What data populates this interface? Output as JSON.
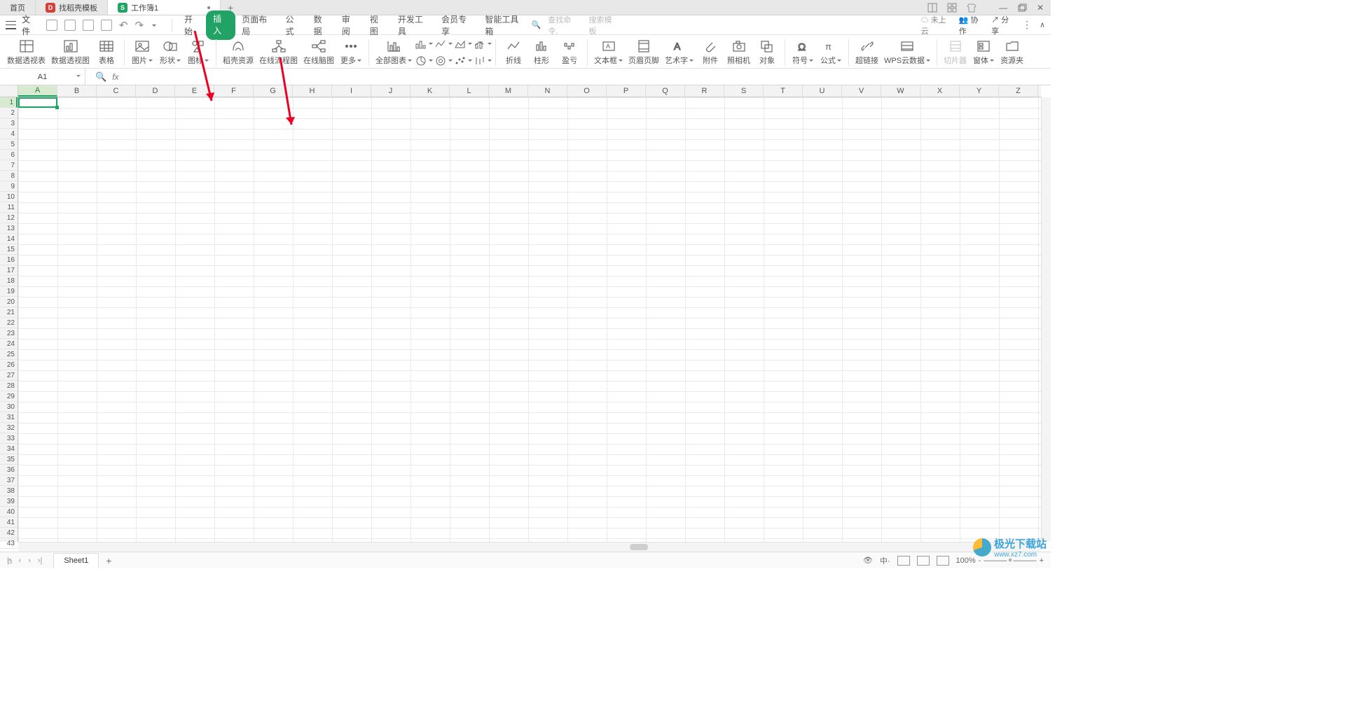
{
  "tabs": {
    "home": "首页",
    "template": "找稻壳模板",
    "workbook": "工作簿1"
  },
  "menu": {
    "file": "文件",
    "items": [
      "开始",
      "插入",
      "页面布局",
      "公式",
      "数据",
      "审阅",
      "视图",
      "开发工具",
      "会员专享",
      "智能工具箱"
    ],
    "active_index": 1,
    "search_cmd": "查找命令,",
    "search_tpl": "搜索模板",
    "cloud": "未上云",
    "collab": "协作",
    "share": "分享"
  },
  "ribbon": {
    "pivot_table": "数据透视表",
    "pivot_chart": "数据透视图",
    "table": "表格",
    "picture": "图片",
    "shape": "形状",
    "icon": "图标",
    "docer": "稻壳资源",
    "flow": "在线流程图",
    "mind": "在线脑图",
    "more": "更多",
    "all_charts": "全部图表",
    "spark_line": "折线",
    "spark_col": "柱形",
    "spark_wl": "盈亏",
    "textbox": "文本框",
    "header_footer": "页眉页脚",
    "wordart": "艺术字",
    "attach": "附件",
    "camera": "照相机",
    "object": "对象",
    "symbol": "符号",
    "equation": "公式",
    "hyperlink": "超链接",
    "wps_cloud": "WPS云数据",
    "slicer": "切片器",
    "form": "窗体",
    "res_folder": "资源夹"
  },
  "namebox": "A1",
  "columns": [
    "A",
    "B",
    "C",
    "D",
    "E",
    "F",
    "G",
    "H",
    "I",
    "J",
    "K",
    "L",
    "M",
    "N",
    "O",
    "P",
    "Q",
    "R",
    "S",
    "T",
    "U",
    "V",
    "W",
    "X",
    "Y",
    "Z"
  ],
  "row_count": 43,
  "active_col": "A",
  "active_row": 1,
  "sheet_tab": "Sheet1",
  "status": {
    "zoom": "100%"
  },
  "watermark": {
    "brand": "极光下载站",
    "url": "www.xz7.com"
  }
}
